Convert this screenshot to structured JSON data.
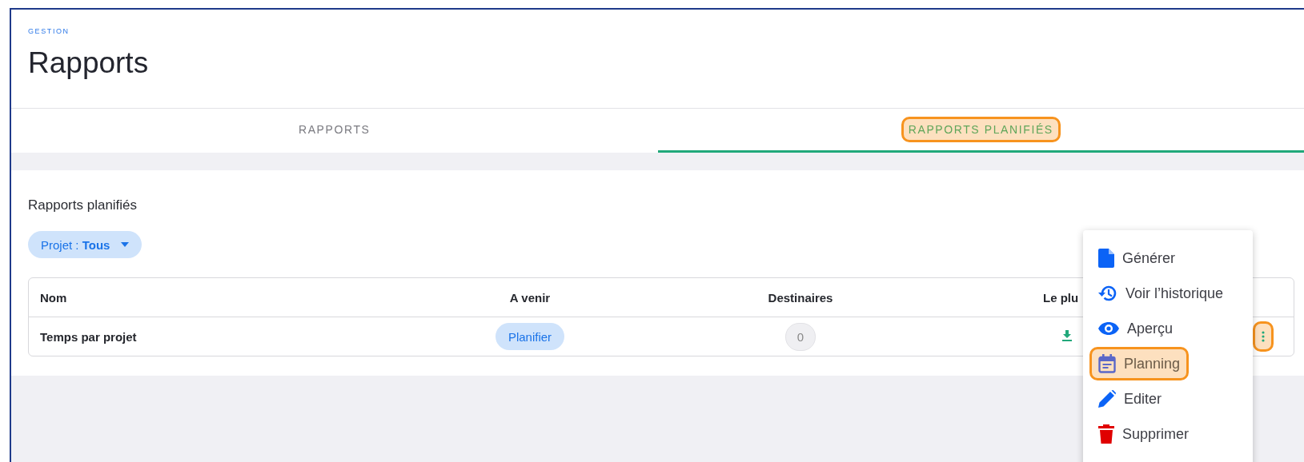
{
  "header": {
    "section": "GESTION",
    "title": "Rapports"
  },
  "tabs": [
    {
      "label": "RAPPORTS",
      "selected": false,
      "highlighted": false
    },
    {
      "label": "RAPPORTS PLANIFIÉS",
      "selected": true,
      "highlighted": true
    }
  ],
  "panel": {
    "title": "Rapports planifiés",
    "filter": {
      "label": "Projet : ",
      "value": "Tous"
    }
  },
  "table": {
    "columns": [
      "Nom",
      "A venir",
      "Destinaires",
      "Le plu"
    ],
    "rows": [
      {
        "name": "Temps par projet",
        "upcoming": "Planifier",
        "recipients": "0",
        "menu_highlighted": true
      }
    ]
  },
  "menu": [
    {
      "label": "Générer",
      "kind": "file",
      "highlighted": false
    },
    {
      "label": "Voir l’historique",
      "kind": "history",
      "highlighted": false
    },
    {
      "label": "Aperçu",
      "kind": "eye",
      "highlighted": false
    },
    {
      "label": "Planning",
      "kind": "calendar",
      "highlighted": true
    },
    {
      "label": "Editer",
      "kind": "pencil",
      "highlighted": false
    },
    {
      "label": "Supprimer",
      "kind": "trash",
      "highlighted": false
    }
  ]
}
